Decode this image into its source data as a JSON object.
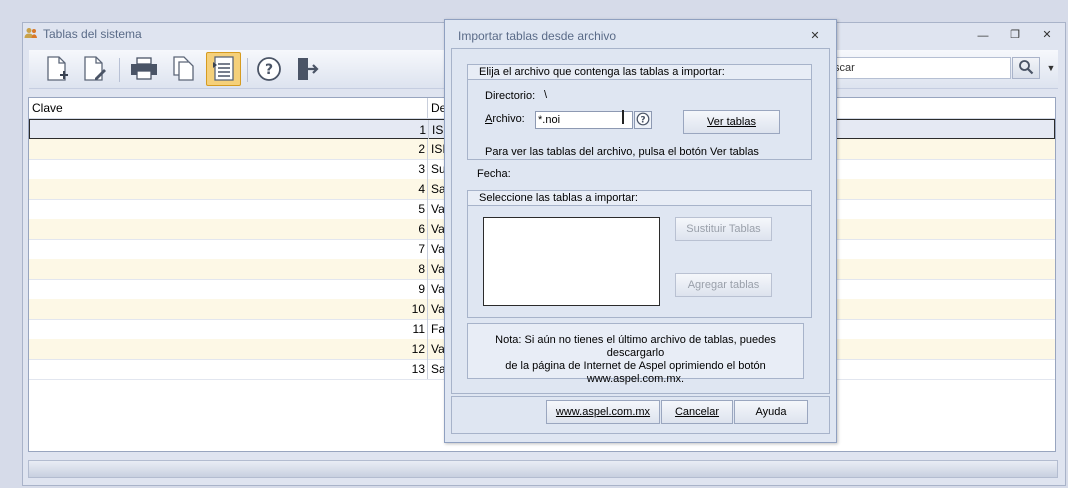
{
  "main_window": {
    "title": "Tablas del sistema",
    "icon": "users-icon",
    "controls": [
      "minimize-icon",
      "restore-icon",
      "close-icon"
    ]
  },
  "toolbar": {
    "buttons": [
      "new-document-icon",
      "edit-document-icon",
      "print-icon",
      "copy-icon",
      "import-tables-icon",
      "help-icon",
      "exit-icon"
    ],
    "search_value": "scar"
  },
  "grid": {
    "columns": [
      "Clave",
      "De"
    ],
    "rows": [
      {
        "clave": "1",
        "desc": "ISI"
      },
      {
        "clave": "2",
        "desc": "ISI"
      },
      {
        "clave": "3",
        "desc": "Su"
      },
      {
        "clave": "4",
        "desc": "Sa"
      },
      {
        "clave": "5",
        "desc": "Va"
      },
      {
        "clave": "6",
        "desc": "Va"
      },
      {
        "clave": "7",
        "desc": "Va"
      },
      {
        "clave": "8",
        "desc": "Va"
      },
      {
        "clave": "9",
        "desc": "Va"
      },
      {
        "clave": "10",
        "desc": "Va"
      },
      {
        "clave": "11",
        "desc": "Fa"
      },
      {
        "clave": "12",
        "desc": "Va"
      },
      {
        "clave": "13",
        "desc": "Sa"
      }
    ]
  },
  "dialog": {
    "title": "Importar tablas desde archivo",
    "file_group_title": "Elija el archivo que contenga las tablas a importar:",
    "directory_label": "Directorio:",
    "directory_value": "\\",
    "file_label": "Archivo:",
    "file_value": "*.noi",
    "view_tables_button": "Ver tablas",
    "hint": "Para ver las tablas del archivo, pulsa el botón Ver tablas",
    "date_label": "Fecha:",
    "select_group_title": "Seleccione las tablas a importar:",
    "replace_button": "Sustituir Tablas",
    "add_button": "Agregar tablas",
    "note_lines": [
      "Nota: Si aún no tienes el último archivo de tablas, puedes descargarlo",
      "de la página de Internet de Aspel oprimiendo el botón",
      "www.aspel.com.mx."
    ],
    "website_button": "www.aspel.com.mx",
    "cancel_button": "Cancelar",
    "help_button": "Ayuda"
  }
}
